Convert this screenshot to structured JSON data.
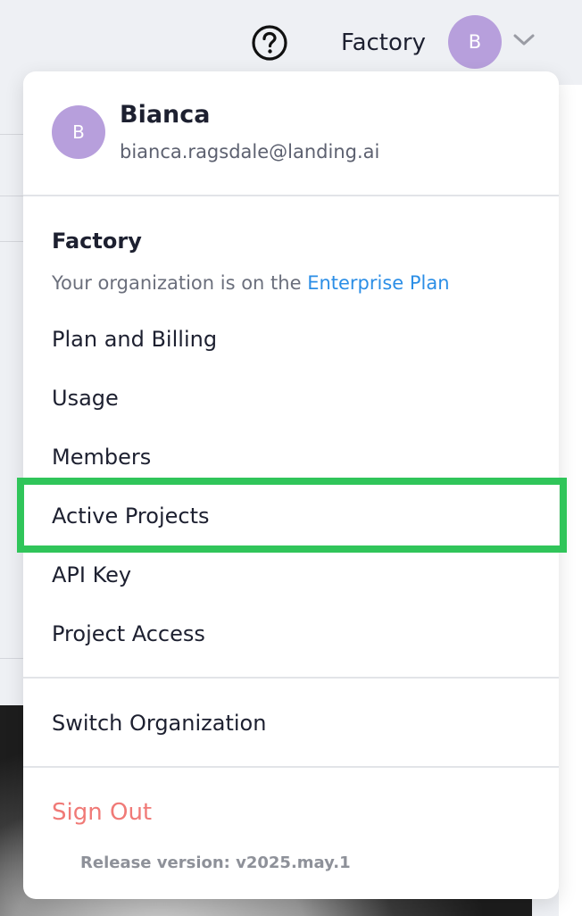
{
  "topbar": {
    "help_icon": "question-circle-icon",
    "org_name": "Factory",
    "avatar_initial": "B",
    "chevron_icon": "chevron-down-icon"
  },
  "user": {
    "avatar_initial": "B",
    "name": "Bianca",
    "email": "bianca.ragsdale@landing.ai"
  },
  "organization": {
    "name": "Factory",
    "plan_prefix": "Your organization is on the ",
    "plan_link": "Enterprise Plan"
  },
  "menu": {
    "items": [
      {
        "label": "Plan and Billing"
      },
      {
        "label": "Usage"
      },
      {
        "label": "Members"
      },
      {
        "label": "Active Projects",
        "highlighted": true
      },
      {
        "label": "API Key"
      },
      {
        "label": "Project Access"
      }
    ],
    "switch_org": "Switch Organization",
    "sign_out": "Sign Out",
    "release_version": "Release version: v2025.may.1"
  },
  "colors": {
    "avatar": "#b79fdc",
    "link": "#2b8ee6",
    "sign_out": "#f07a77",
    "highlight": "#30c55a"
  }
}
